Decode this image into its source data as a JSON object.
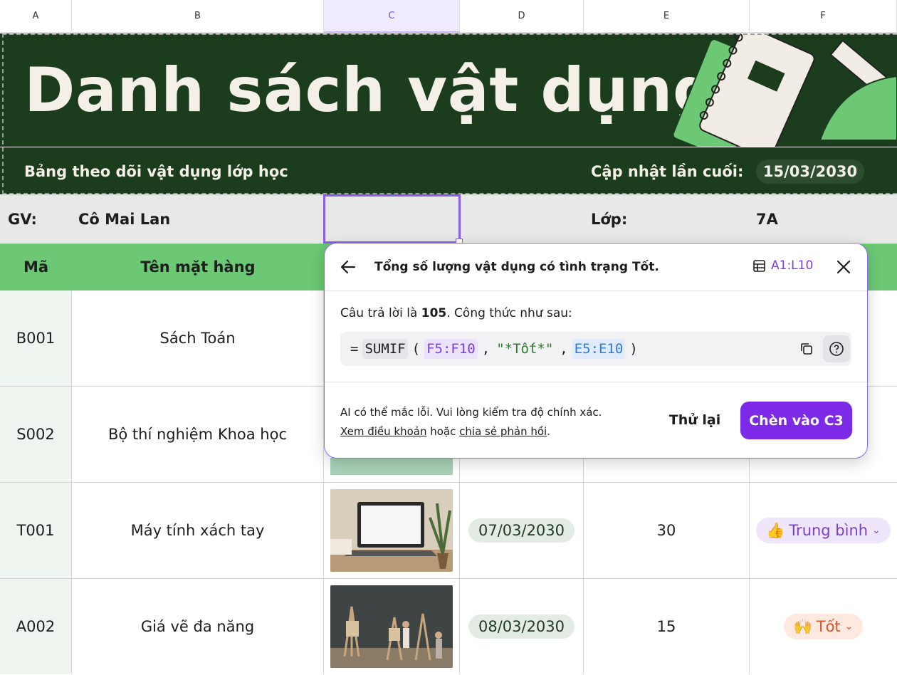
{
  "columns": [
    "A",
    "B",
    "C",
    "D",
    "E",
    "F"
  ],
  "selected_column": "C",
  "banner": {
    "title": "Danh sách vật dụng",
    "subtitle": "Bảng theo dõi vật dụng lớp học",
    "updated_label": "Cập nhật lần cuối:",
    "updated_date": "15/03/2030"
  },
  "teacher_row": {
    "gv_label": "GV:",
    "gv_value": "Cô Mai Lan",
    "class_label": "Lớp:",
    "class_value": "7A"
  },
  "table_headers": {
    "code": "Mã",
    "name": "Tên mặt hàng"
  },
  "rows": [
    {
      "code": "B001",
      "name": "Sách Toán"
    },
    {
      "code": "S002",
      "name": "Bộ thí nghiệm Khoa học"
    },
    {
      "code": "T001",
      "name": "Máy tính xách tay",
      "date": "07/03/2030",
      "qty": "30",
      "status": "Trung bình",
      "status_emoji": "👍"
    },
    {
      "code": "A002",
      "name": "Giá vẽ đa năng",
      "date": "08/03/2030",
      "qty": "15",
      "status": "Tốt",
      "status_emoji": "🙌"
    }
  ],
  "ai_popover": {
    "title": "Tổng số lượng vật dụng có tình trạng Tốt.",
    "range": "A1:L10",
    "answer_prefix": "Câu trả lời là ",
    "answer_value": "105",
    "answer_suffix": ". Công thức như sau:",
    "formula": {
      "eq": "=",
      "fn": "SUMIF",
      "open": "(",
      "arg1": "F5:F10",
      "comma1": ",",
      "arg2": "\"*Tốt*\"",
      "comma2": ",",
      "arg3": "E5:E10",
      "close": ")"
    },
    "disclaimer_line1": "AI có thể mắc lỗi. Vui lòng kiểm tra độ chính xác.",
    "terms_link": "Xem điều khoản",
    "or_text": " hoặc ",
    "feedback_link": "chia sẻ phản hồi",
    "period": ".",
    "retry_label": "Thử lại",
    "insert_label": "Chèn vào C3"
  },
  "colors": {
    "banner_bg": "#1b3d1e",
    "header_green": "#6cc874",
    "accent_purple": "#7d2ae8"
  }
}
